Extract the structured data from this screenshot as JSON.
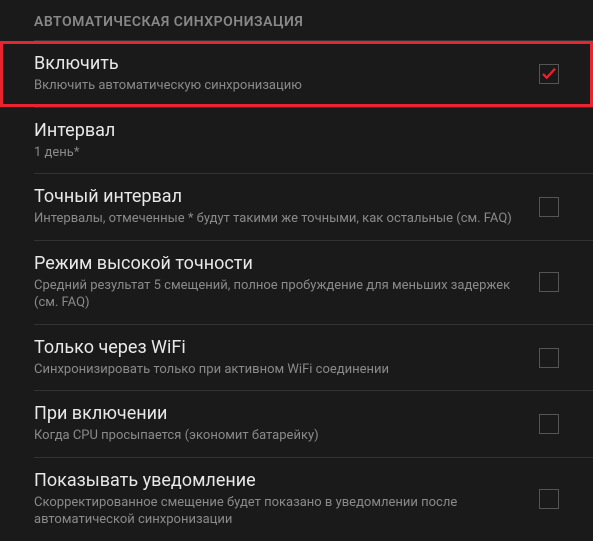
{
  "section": {
    "title": "АВТОМАТИЧЕСКАЯ СИНХРОНИЗАЦИЯ"
  },
  "items": [
    {
      "title": "Включить",
      "description": "Включить автоматическую синхронизацию",
      "checked": true,
      "highlighted": true,
      "hasCheckbox": true
    },
    {
      "title": "Интервал",
      "description": "1 день*",
      "checked": false,
      "highlighted": false,
      "hasCheckbox": false
    },
    {
      "title": "Точный интервал",
      "description": "Интервалы, отмеченные * будут такими же точными, как остальные (см. FAQ)",
      "checked": false,
      "highlighted": false,
      "hasCheckbox": true
    },
    {
      "title": "Режим высокой точности",
      "description": "Средний результат 5 смещений, полное пробуждение для меньших задержек (см. FAQ)",
      "checked": false,
      "highlighted": false,
      "hasCheckbox": true
    },
    {
      "title": "Только через WiFi",
      "description": "Синхронизировать только при активном WiFi соединении",
      "checked": false,
      "highlighted": false,
      "hasCheckbox": true
    },
    {
      "title": "При включении",
      "description": "Когда CPU просыпается (экономит батарейку)",
      "checked": false,
      "highlighted": false,
      "hasCheckbox": true
    },
    {
      "title": "Показывать уведомление",
      "description": "Скорректированное смещение будет показано в уведомлении после автоматической синхронизации",
      "checked": false,
      "highlighted": false,
      "hasCheckbox": true
    }
  ]
}
